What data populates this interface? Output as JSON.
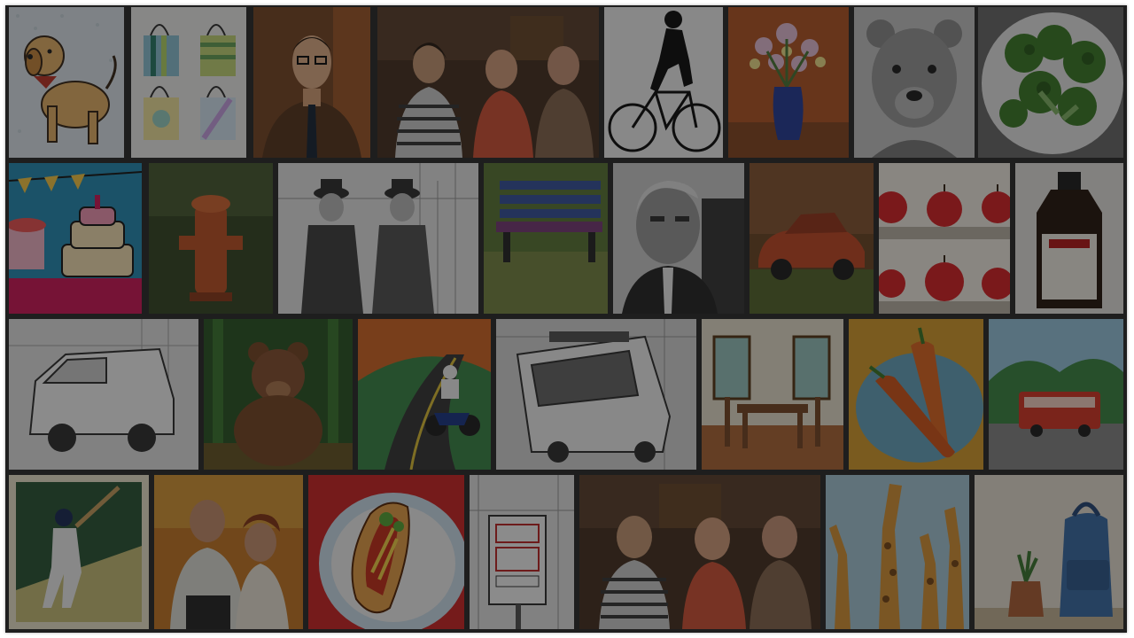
{
  "gallery": {
    "overlay_color": "#0a0a0a",
    "rows": [
      {
        "tiles": [
          {
            "subject": "cartoon-dog-icon"
          },
          {
            "subject": "tote-bags-icon"
          },
          {
            "subject": "man-in-tie-portrait-icon"
          },
          {
            "subject": "people-talking-photo-icon"
          },
          {
            "subject": "cyclist-silhouette-icon"
          },
          {
            "subject": "flower-vase-painting-icon"
          },
          {
            "subject": "bear-sketch-icon"
          },
          {
            "subject": "broccoli-plate-icon"
          }
        ]
      },
      {
        "tiles": [
          {
            "subject": "birthday-cakes-popart-icon"
          },
          {
            "subject": "fire-hydrant-painting-icon"
          },
          {
            "subject": "two-men-sketch-icon"
          },
          {
            "subject": "park-bench-painting-icon"
          },
          {
            "subject": "old-man-portrait-icon"
          },
          {
            "subject": "red-car-painting-icon"
          },
          {
            "subject": "apples-shelves-icon"
          },
          {
            "subject": "vanilla-extract-bottle-icon"
          }
        ]
      },
      {
        "tiles": [
          {
            "subject": "van-sketch-icon"
          },
          {
            "subject": "brown-bear-forest-icon"
          },
          {
            "subject": "motorcyclist-road-icon"
          },
          {
            "subject": "city-bus-sketch-icon"
          },
          {
            "subject": "dining-room-illustration-icon"
          },
          {
            "subject": "carrots-plate-icon"
          },
          {
            "subject": "red-bus-landscape-icon"
          }
        ]
      },
      {
        "tiles": [
          {
            "subject": "baseball-batter-icon"
          },
          {
            "subject": "couple-outdoors-photo-icon"
          },
          {
            "subject": "hot-dog-plate-icon"
          },
          {
            "subject": "street-sign-sketch-icon"
          },
          {
            "subject": "people-talking-photo-2-icon"
          },
          {
            "subject": "giraffes-illustration-icon"
          },
          {
            "subject": "backpack-plant-icon"
          }
        ]
      }
    ]
  }
}
